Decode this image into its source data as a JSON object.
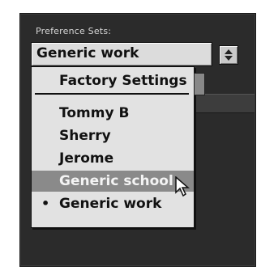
{
  "preferences": {
    "label": "Preference Sets:",
    "current_value": "Generic work",
    "menu_items": [
      {
        "label": "Factory Settings"
      },
      {
        "label": "Tommy B"
      },
      {
        "label": "Sherry"
      },
      {
        "label": "Jerome"
      },
      {
        "label": "Generic school",
        "highlighted": true
      },
      {
        "label": "Generic work",
        "checked": true
      }
    ],
    "bullet": "•"
  },
  "icons": {
    "stepper": "up-down-arrows-icon",
    "cursor": "pointer-icon"
  }
}
